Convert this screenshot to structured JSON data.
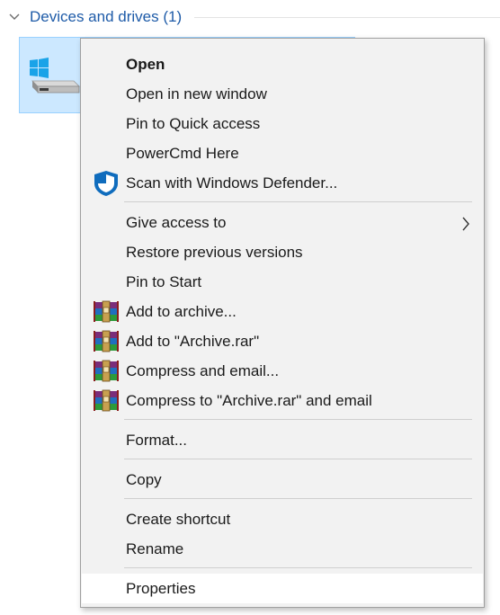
{
  "group": {
    "title": "Devices and drives (1)",
    "chevron_icon": "chevron-down-icon"
  },
  "drive": {
    "icon": "hard-drive-windows-icon",
    "accent_color": "#cce8ff"
  },
  "menu": {
    "items": [
      {
        "label": "Open",
        "bold": true,
        "icon": "",
        "submenu": false
      },
      {
        "label": "Open in new window",
        "icon": "",
        "submenu": false
      },
      {
        "label": "Pin to Quick access",
        "icon": "",
        "submenu": false
      },
      {
        "label": "PowerCmd Here",
        "icon": "",
        "submenu": false
      },
      {
        "label": "Scan with Windows Defender...",
        "icon": "windows-defender-shield-icon",
        "submenu": false
      },
      {
        "label": "Give access to",
        "icon": "",
        "submenu": true
      },
      {
        "label": "Restore previous versions",
        "icon": "",
        "submenu": false
      },
      {
        "label": "Pin to Start",
        "icon": "",
        "submenu": false
      },
      {
        "label": "Add to archive...",
        "icon": "winrar-icon",
        "submenu": false
      },
      {
        "label": "Add to \"Archive.rar\"",
        "icon": "winrar-icon",
        "submenu": false
      },
      {
        "label": "Compress and email...",
        "icon": "winrar-icon",
        "submenu": false
      },
      {
        "label": "Compress to \"Archive.rar\" and email",
        "icon": "winrar-icon",
        "submenu": false
      },
      {
        "label": "Format...",
        "icon": "",
        "submenu": false
      },
      {
        "label": "Copy",
        "icon": "",
        "submenu": false
      },
      {
        "label": "Create shortcut",
        "icon": "",
        "submenu": false
      },
      {
        "label": "Rename",
        "icon": "",
        "submenu": false
      },
      {
        "label": "Properties",
        "icon": "",
        "submenu": false,
        "hovered": true
      }
    ]
  },
  "colors": {
    "link_blue": "#1e5ba8",
    "menu_bg": "#f2f2f2",
    "selection": "#cce8ff",
    "defender_blue": "#0f6cbd"
  }
}
